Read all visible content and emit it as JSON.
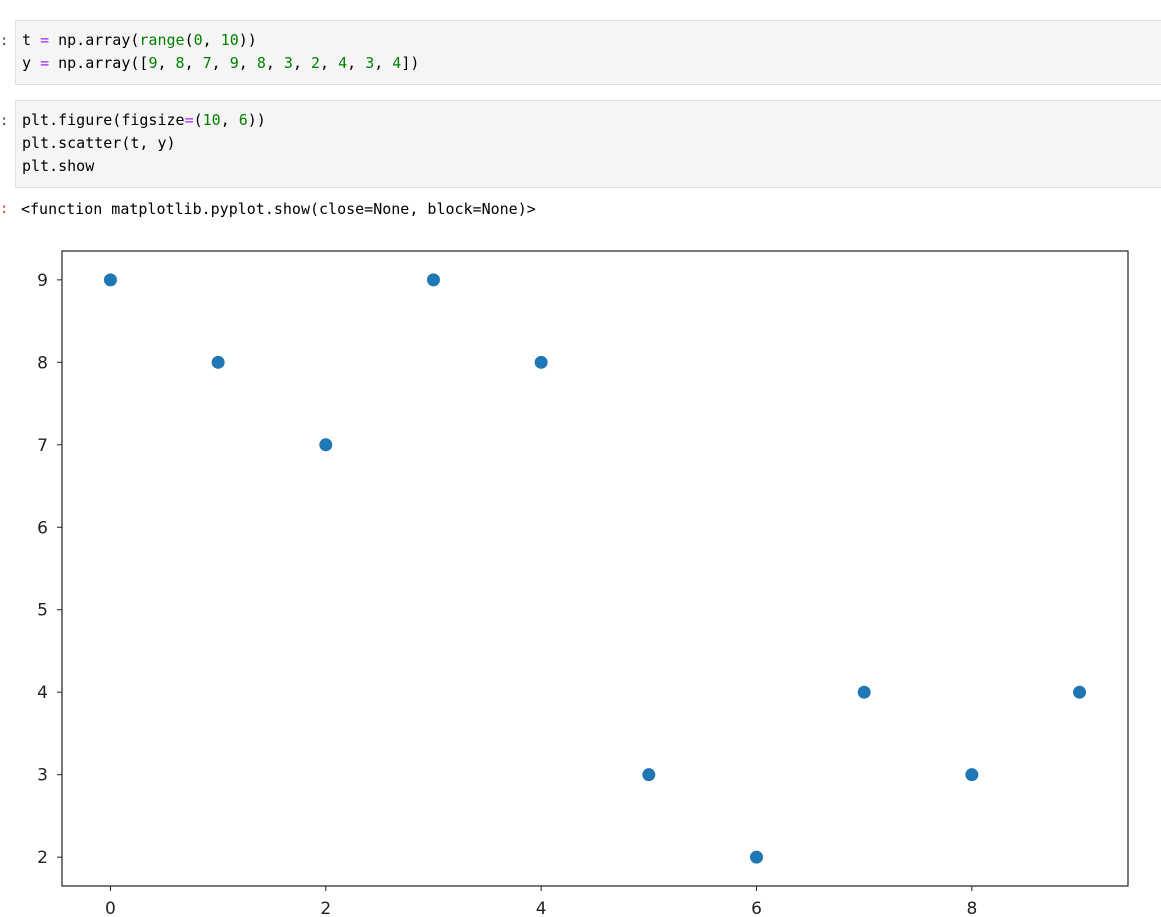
{
  "cells": [
    {
      "prompt": ":",
      "lines": [
        [
          {
            "t": "t "
          },
          {
            "t": "=",
            "c": "k"
          },
          {
            "t": " np.array("
          },
          {
            "t": "range",
            "c": "bi"
          },
          {
            "t": "("
          },
          {
            "t": "0",
            "c": "n"
          },
          {
            "t": ", "
          },
          {
            "t": "10",
            "c": "n"
          },
          {
            "t": "))"
          }
        ],
        [
          {
            "t": "y "
          },
          {
            "t": "=",
            "c": "k"
          },
          {
            "t": " np.array(["
          },
          {
            "t": "9",
            "c": "n"
          },
          {
            "t": ", "
          },
          {
            "t": "8",
            "c": "n"
          },
          {
            "t": ", "
          },
          {
            "t": "7",
            "c": "n"
          },
          {
            "t": ", "
          },
          {
            "t": "9",
            "c": "n"
          },
          {
            "t": ", "
          },
          {
            "t": "8",
            "c": "n"
          },
          {
            "t": ", "
          },
          {
            "t": "3",
            "c": "n"
          },
          {
            "t": ", "
          },
          {
            "t": "2",
            "c": "n"
          },
          {
            "t": ", "
          },
          {
            "t": "4",
            "c": "n"
          },
          {
            "t": ", "
          },
          {
            "t": "3",
            "c": "n"
          },
          {
            "t": ", "
          },
          {
            "t": "4",
            "c": "n"
          },
          {
            "t": "])"
          }
        ]
      ]
    },
    {
      "prompt": ":",
      "lines": [
        [
          {
            "t": "plt.figure(figsize"
          },
          {
            "t": "=",
            "c": "k"
          },
          {
            "t": "("
          },
          {
            "t": "10",
            "c": "n"
          },
          {
            "t": ", "
          },
          {
            "t": "6",
            "c": "n"
          },
          {
            "t": "))"
          }
        ],
        [
          {
            "t": "plt.scatter(t, y)"
          }
        ],
        [
          {
            "t": "plt.show"
          }
        ]
      ]
    }
  ],
  "output": {
    "prompt": ":",
    "text": "<function matplotlib.pyplot.show(close=None, block=None)>"
  },
  "chart_data": {
    "type": "scatter",
    "x": [
      0,
      1,
      2,
      3,
      4,
      5,
      6,
      7,
      8,
      9
    ],
    "y": [
      9,
      8,
      7,
      9,
      8,
      3,
      2,
      4,
      3,
      4
    ],
    "xticks": [
      0,
      2,
      4,
      6,
      8
    ],
    "yticks": [
      2,
      3,
      4,
      5,
      6,
      7,
      8,
      9
    ],
    "xlim": [
      -0.45,
      9.45
    ],
    "ylim": [
      1.65,
      9.35
    ],
    "title": "",
    "xlabel": "",
    "ylabel": "",
    "grid": false,
    "marker_color": "#1f77b4"
  }
}
